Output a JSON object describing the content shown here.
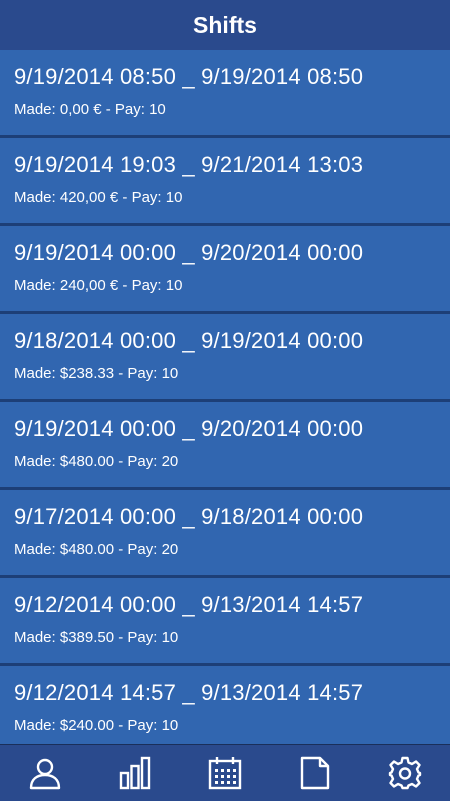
{
  "header": {
    "title": "Shifts"
  },
  "shifts": [
    {
      "dates": "9/19/2014 08:50 _ 9/19/2014 08:50",
      "info": "Made: 0,00 € - Pay: 10"
    },
    {
      "dates": "9/19/2014 19:03 _ 9/21/2014 13:03",
      "info": "Made: 420,00 € - Pay: 10"
    },
    {
      "dates": "9/19/2014 00:00 _ 9/20/2014 00:00",
      "info": "Made: 240,00 € - Pay: 10"
    },
    {
      "dates": "9/18/2014 00:00 _ 9/19/2014 00:00",
      "info": "Made: $238.33 - Pay: 10"
    },
    {
      "dates": "9/19/2014 00:00 _ 9/20/2014 00:00",
      "info": "Made: $480.00 - Pay: 20"
    },
    {
      "dates": "9/17/2014 00:00 _ 9/18/2014 00:00",
      "info": "Made: $480.00 - Pay: 20"
    },
    {
      "dates": "9/12/2014 00:00 _ 9/13/2014 14:57",
      "info": "Made: $389.50 - Pay: 10"
    },
    {
      "dates": "9/12/2014 14:57 _ 9/13/2014 14:57",
      "info": "Made: $240.00 - Pay: 10"
    }
  ],
  "bottom_nav": [
    {
      "icon": "user-icon"
    },
    {
      "icon": "bar-chart-icon"
    },
    {
      "icon": "calendar-icon"
    },
    {
      "icon": "document-icon"
    },
    {
      "icon": "gear-icon"
    }
  ],
  "colors": {
    "header_bg": "#2a4a8d",
    "row_bg": "#3166b0",
    "separator": "#1d3f77",
    "text": "#ffffff"
  }
}
